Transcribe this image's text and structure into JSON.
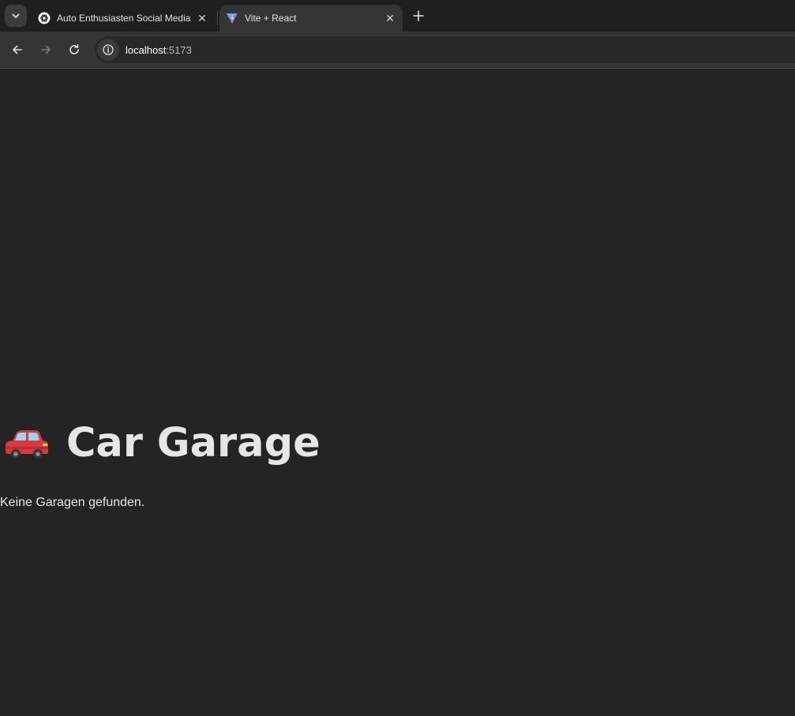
{
  "browser": {
    "tabs": [
      {
        "title": "Auto Enthusiasten Social Media",
        "favicon": "openai-icon",
        "active": false
      },
      {
        "title": "Vite + React",
        "favicon": "vite-icon",
        "active": true
      }
    ],
    "url_host": "localhost",
    "url_port": ":5173"
  },
  "page": {
    "heading": "Car Garage",
    "heading_icon": "car-icon",
    "empty_message": "Keine Garagen gefunden."
  },
  "colors": {
    "background": "#242424",
    "text": "#e6e6e6",
    "tab_active": "#353535"
  }
}
